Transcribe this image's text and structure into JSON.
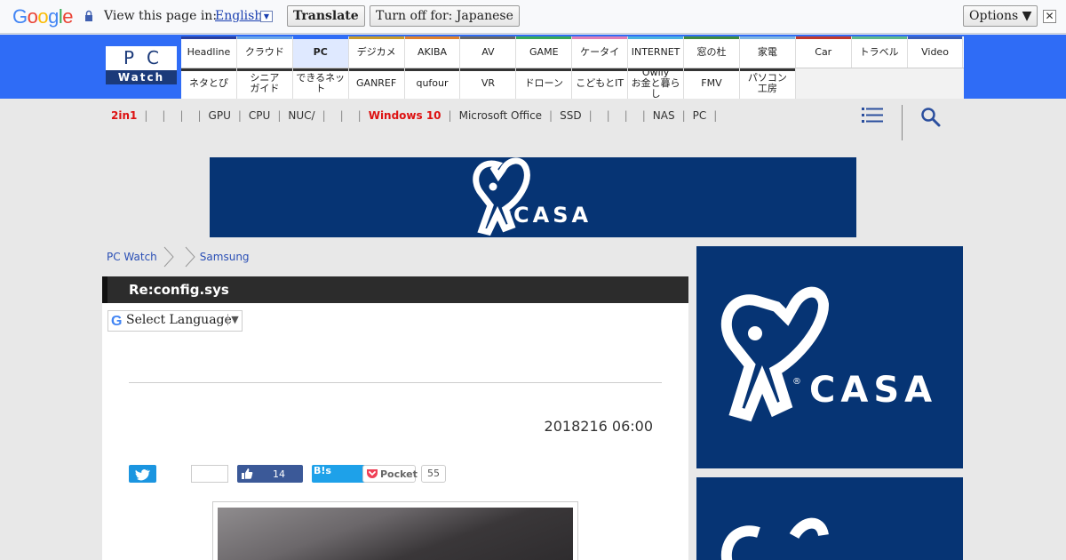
{
  "translate_bar": {
    "view_label": "View this page in:",
    "language": "English",
    "translate_button": "Translate",
    "turn_off_button": "Turn off for: Japanese",
    "options_button": "Options ▼",
    "close_glyph": "✕"
  },
  "header": {
    "logo_top": "PC",
    "logo_bottom": "Watch",
    "nav_row1": [
      "Headline",
      "クラウド",
      "PC",
      "デジカメ",
      "AKIBA",
      "AV",
      "GAME",
      "ケータイ",
      "INTERNET",
      "窓の杜",
      "家電",
      "Car",
      "トラベル",
      "Video"
    ],
    "nav_row1_colors": [
      "#2a3f9d",
      "#6aa6e8",
      "#2f6cf6",
      "#c89a2a",
      "#e0812c",
      "#666666",
      "#38a857",
      "#e07fb5",
      "#4bb3e0",
      "#3f8a3f",
      "#7fb6e0",
      "#c0392b",
      "#5fb88a",
      "#3b5fb8"
    ],
    "nav_row2": [
      "ネタとぴ",
      "シニア\nガイド",
      "できるネット",
      "GANREF",
      "qufour",
      "VR",
      "ドローン",
      "こどもとIT",
      "Owlly\nお金と暮らし",
      "FMV",
      "パソコン\n工房"
    ]
  },
  "keywords": {
    "items": [
      "2in1",
      "",
      "",
      "",
      "GPU",
      "CPU",
      "NUC/",
      "",
      "",
      "Windows 10",
      "Microsoft Office",
      "SSD",
      "",
      "",
      "",
      "NAS",
      "PC"
    ],
    "hot": [
      0,
      9
    ]
  },
  "ads": {
    "brand": "CASA"
  },
  "breadcrumb": [
    "PC Watch",
    "",
    "Samsung"
  ],
  "article": {
    "title": "Re:config.sys",
    "language_select": "Select Language",
    "date": "2018216 06:00",
    "fb_count": "14",
    "hatena_label": "B!s",
    "pocket_label": "Pocket",
    "pocket_count": "55"
  }
}
